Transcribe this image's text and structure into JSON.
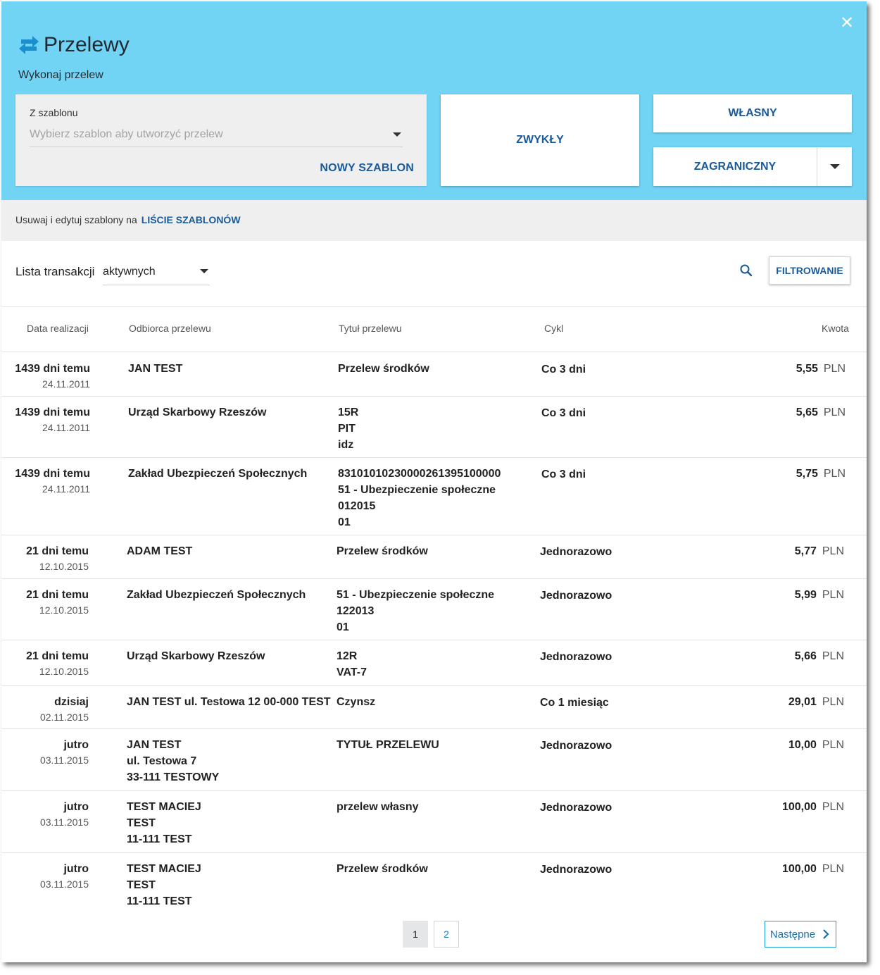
{
  "header": {
    "title": "Przelewy",
    "subtitle": "Wykonaj przelew",
    "close_icon": "close-icon",
    "title_icon": "transfer-arrows-icon",
    "bg_color": "#72d4f5"
  },
  "template_box": {
    "label": "Z szablonu",
    "placeholder": "Wybierz szablon aby utworzyć przelew",
    "new_template_label": "NOWY SZABLON"
  },
  "transfer_types": {
    "zwykly": "ZWYKŁY",
    "wlasny": "WŁASNY",
    "zagraniczny": "ZAGRANICZNY"
  },
  "info_bar": {
    "text": "Usuwaj i edytuj szablony na",
    "link": "LIŚCIE SZABLONÓW"
  },
  "list": {
    "label": "Lista transakcji",
    "selected": "aktywnych",
    "filter_label": "FILTROWANIE"
  },
  "table": {
    "headers": {
      "date": "Data realizacji",
      "recipient": "Odbiorca przelewu",
      "title": "Tytuł przelewu",
      "cycle": "Cykl",
      "amount": "Kwota"
    },
    "rows": [
      {
        "when": "1439 dni temu",
        "date": "24.11.2011",
        "recipient": [
          "JAN TEST"
        ],
        "title": [
          "Przelew środków"
        ],
        "cycle": "Co 3 dni",
        "amount": "5,55",
        "currency": "PLN"
      },
      {
        "when": "1439 dni temu",
        "date": "24.11.2011",
        "recipient": [
          "Urząd Skarbowy Rzeszów"
        ],
        "title": [
          "15R",
          "PIT",
          "idz"
        ],
        "cycle": "Co 3 dni",
        "amount": "5,65",
        "currency": "PLN"
      },
      {
        "when": "1439 dni temu",
        "date": "24.11.2011",
        "recipient": [
          "Zakład Ubezpieczeń Społecznych"
        ],
        "title": [
          "83101010230000261395100000",
          "51 - Ubezpieczenie społeczne",
          "012015",
          "01"
        ],
        "cycle": "Co 3 dni",
        "amount": "5,75",
        "currency": "PLN"
      },
      {
        "when": "21 dni temu",
        "date": "12.10.2015",
        "recipient": [
          "ADAM TEST"
        ],
        "title": [
          "Przelew środków"
        ],
        "cycle": "Jednorazowo",
        "amount": "5,77",
        "currency": "PLN"
      },
      {
        "when": "21 dni temu",
        "date": "12.10.2015",
        "recipient": [
          "Zakład Ubezpieczeń Społecznych"
        ],
        "title": [
          "51 - Ubezpieczenie społeczne",
          "122013",
          "01"
        ],
        "cycle": "Jednorazowo",
        "amount": "5,99",
        "currency": "PLN"
      },
      {
        "when": "21 dni temu",
        "date": "12.10.2015",
        "recipient": [
          "Urząd Skarbowy Rzeszów"
        ],
        "title": [
          "12R",
          "VAT-7"
        ],
        "cycle": "Jednorazowo",
        "amount": "5,66",
        "currency": "PLN"
      },
      {
        "when": "dzisiaj",
        "date": "02.11.2015",
        "recipient": [
          "JAN TEST ul. Testowa 12 00-000 TEST"
        ],
        "title": [
          "Czynsz"
        ],
        "cycle": "Co 1 miesiąc",
        "amount": "29,01",
        "currency": "PLN"
      },
      {
        "when": "jutro",
        "date": "03.11.2015",
        "recipient": [
          "JAN TEST",
          "ul. Testowa 7",
          "33-111 TESTOWY"
        ],
        "title": [
          "TYTUŁ PRZELEWU"
        ],
        "cycle": "Jednorazowo",
        "amount": "10,00",
        "currency": "PLN"
      },
      {
        "when": "jutro",
        "date": "03.11.2015",
        "recipient": [
          "TEST MACIEJ",
          "TEST",
          "11-111 TEST"
        ],
        "title": [
          "przelew własny"
        ],
        "cycle": "Jednorazowo",
        "amount": "100,00",
        "currency": "PLN"
      },
      {
        "when": "jutro",
        "date": "03.11.2015",
        "recipient": [
          "TEST MACIEJ",
          "TEST",
          "11-111 TEST"
        ],
        "title": [
          "Przelew środków"
        ],
        "cycle": "Jednorazowo",
        "amount": "100,00",
        "currency": "PLN"
      }
    ]
  },
  "pagination": {
    "pages": [
      "1",
      "2"
    ],
    "current": "1",
    "next_label": "Następne"
  }
}
